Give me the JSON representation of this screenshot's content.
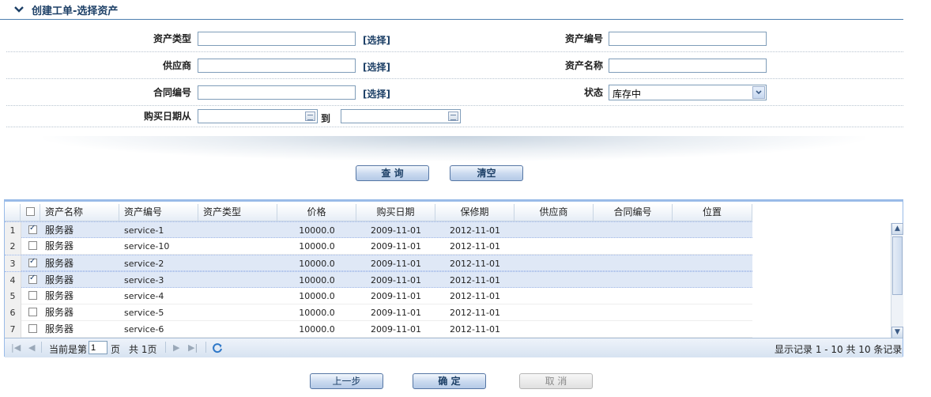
{
  "header": {
    "title": "创建工单-选择资产"
  },
  "form": {
    "asset_type_label": "资产类型",
    "asset_no_label": "资产编号",
    "supplier_label": "供应商",
    "asset_name_label": "资产名称",
    "contract_no_label": "合同编号",
    "status_label": "状态",
    "status_value": "库存中",
    "buy_date_label": "购买日期从",
    "to_label": "到",
    "select_link": "[选择]"
  },
  "buttons": {
    "query": "查 询",
    "clear": "清空",
    "prev": "上一步",
    "confirm": "确 定",
    "cancel": "取 消"
  },
  "grid": {
    "columns": [
      "资产名称",
      "资产编号",
      "资产类型",
      "价格",
      "购买日期",
      "保修期",
      "供应商",
      "合同编号",
      "位置"
    ],
    "rows": [
      {
        "num": "1",
        "checked": true,
        "name": "服务器",
        "code": "service-1",
        "type": "",
        "price": "10000.0",
        "buy_date": "2009-11-01",
        "warranty": "2012-11-01"
      },
      {
        "num": "2",
        "checked": false,
        "name": "服务器",
        "code": "service-10",
        "type": "",
        "price": "10000.0",
        "buy_date": "2009-11-01",
        "warranty": "2012-11-01"
      },
      {
        "num": "3",
        "checked": true,
        "name": "服务器",
        "code": "service-2",
        "type": "",
        "price": "10000.0",
        "buy_date": "2009-11-01",
        "warranty": "2012-11-01"
      },
      {
        "num": "4",
        "checked": true,
        "name": "服务器",
        "code": "service-3",
        "type": "",
        "price": "10000.0",
        "buy_date": "2009-11-01",
        "warranty": "2012-11-01"
      },
      {
        "num": "5",
        "checked": false,
        "name": "服务器",
        "code": "service-4",
        "type": "",
        "price": "10000.0",
        "buy_date": "2009-11-01",
        "warranty": "2012-11-01"
      },
      {
        "num": "6",
        "checked": false,
        "name": "服务器",
        "code": "service-5",
        "type": "",
        "price": "10000.0",
        "buy_date": "2009-11-01",
        "warranty": "2012-11-01"
      },
      {
        "num": "7",
        "checked": false,
        "name": "服务器",
        "code": "service-6",
        "type": "",
        "price": "10000.0",
        "buy_date": "2009-11-01",
        "warranty": "2012-11-01"
      }
    ]
  },
  "pager": {
    "current_page_label": "当前是第",
    "page_value": "1",
    "page_suffix": "页",
    "total_label": "共 1页",
    "summary": "显示记录 1 - 10 共 10 条记录"
  },
  "colors": {
    "accent": "#1c3f66",
    "border": "#99bbe8",
    "selected_row": "#dfe8f6"
  }
}
